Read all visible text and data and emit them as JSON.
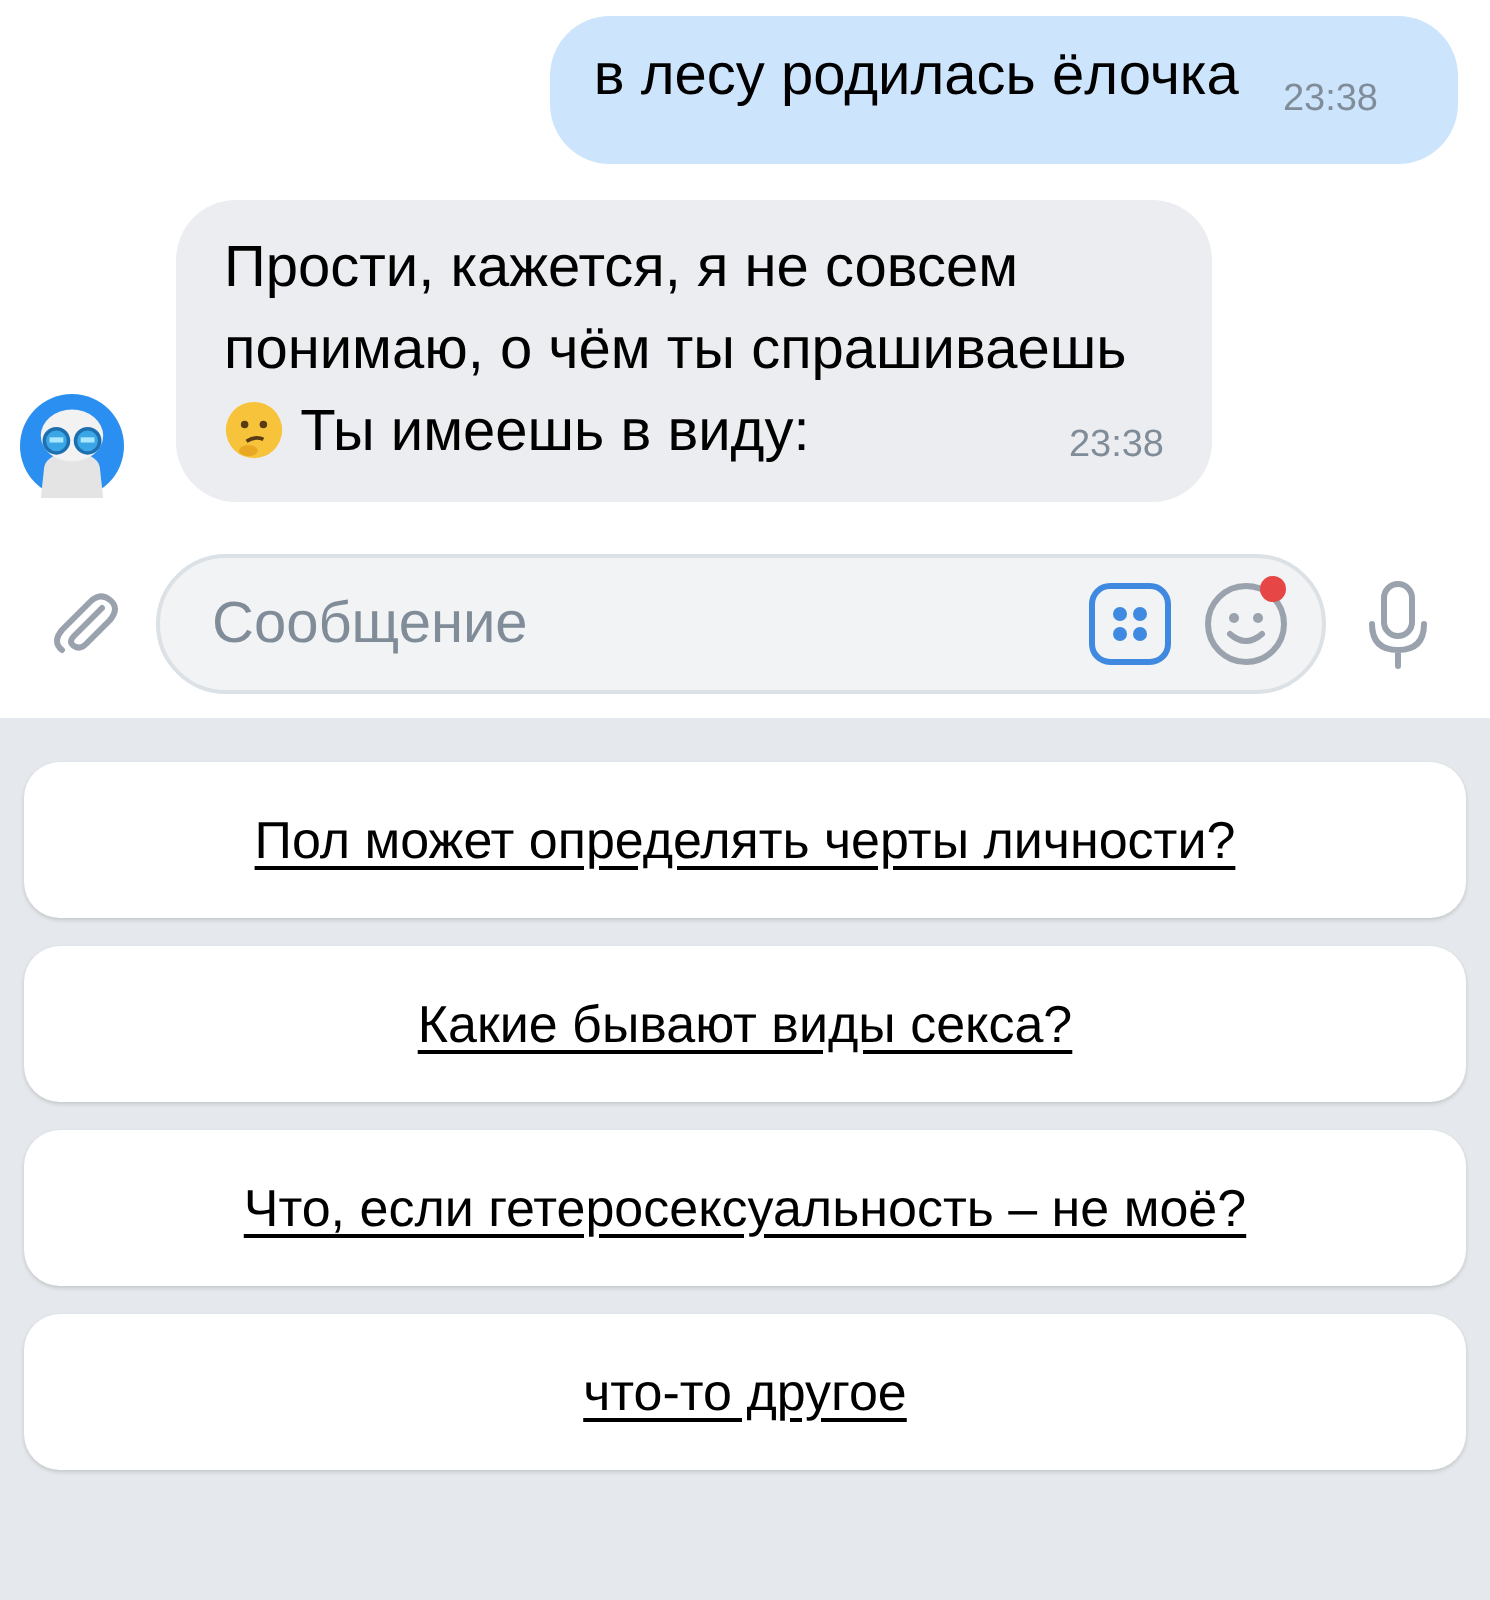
{
  "messages": [
    {
      "outgoing": true,
      "parts": [
        {
          "kind": "text",
          "text": "в лесу родилась ёлочка"
        }
      ],
      "time": "23:38"
    },
    {
      "outgoing": false,
      "parts": [
        {
          "kind": "text",
          "text": "Прости, кажется, я не совсем понимаю, о чём ты спрашиваешь"
        },
        {
          "kind": "emoji"
        },
        {
          "kind": "text",
          "text": "Ты имеешь в виду:"
        }
      ],
      "time": "23:38"
    }
  ],
  "composer": {
    "placeholder": "Сообщение",
    "sticker_badge": true
  },
  "quick_replies": [
    "Пол может определять черты личности?",
    "Какие бывают виды секса?",
    "Что, если гетеросексуальность – не моё?",
    "что-то другое"
  ]
}
